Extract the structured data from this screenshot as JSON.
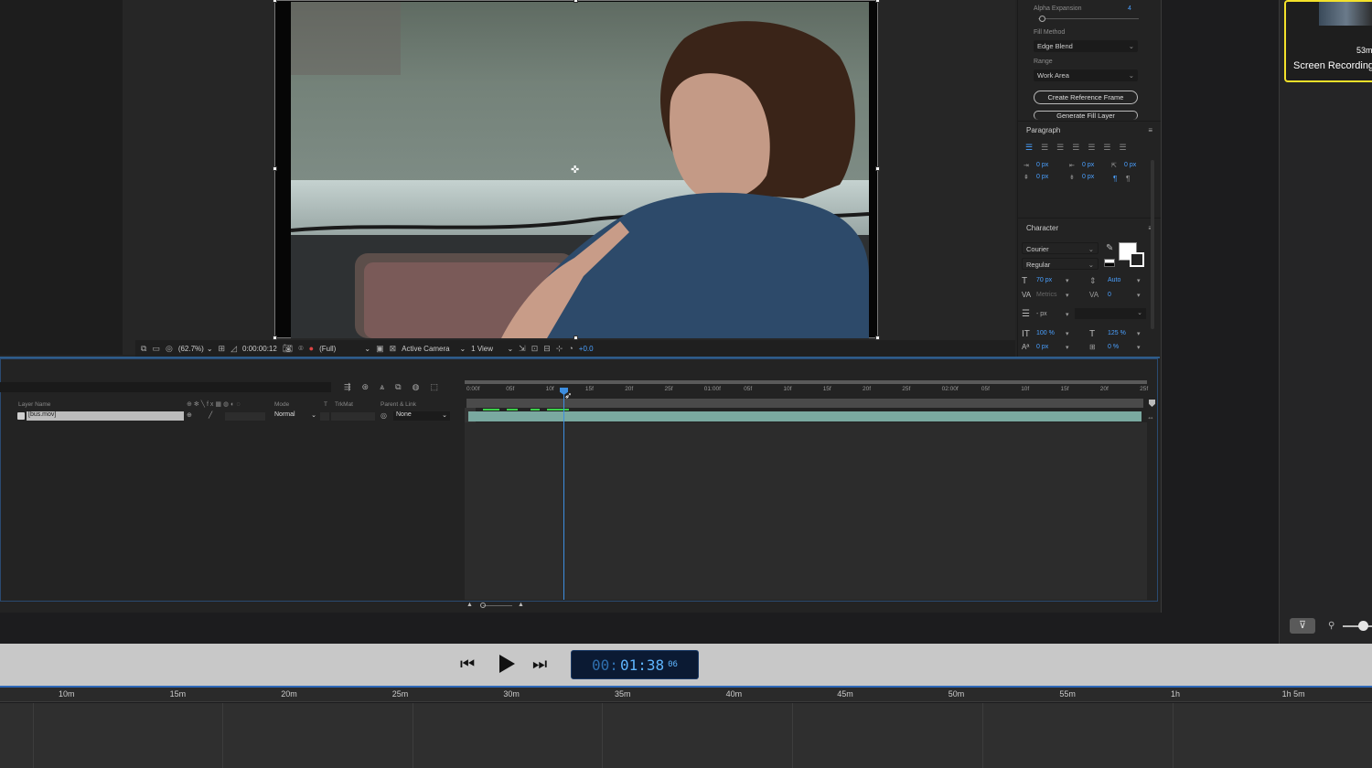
{
  "viewer": {
    "zoom": "(62.7%)",
    "timecode": "0:00:00:12",
    "resolution": "(Full)",
    "camera": "Active Camera",
    "view": "1 View",
    "exposure": "+0.0"
  },
  "fill_panel": {
    "alpha_label": "Alpha Expansion",
    "alpha_value": "4",
    "fill_method_label": "Fill Method",
    "fill_method_value": "Edge Blend",
    "range_label": "Range",
    "range_value": "Work Area",
    "create_ref_btn": "Create Reference Frame",
    "generate_btn": "Generate Fill Layer"
  },
  "paragraph": {
    "title": "Paragraph",
    "indent_left": "0 px",
    "indent_right": "0 px",
    "indent_first": "0 px",
    "space_before": "0 px",
    "space_after": "0 px"
  },
  "character": {
    "title": "Character",
    "font": "Courier",
    "style": "Regular",
    "size": "70 px",
    "leading": "Auto",
    "kerning": "Metrics",
    "tracking": "0",
    "stroke": "- px",
    "vscale": "100 %",
    "hscale": "125 %",
    "baseline": "0 px",
    "tsume": "0 %"
  },
  "timeline": {
    "col_layer_name": "Layer Name",
    "col_mode": "Mode",
    "col_t": "T",
    "col_trkmat": "TrkMat",
    "col_parent": "Parent & Link",
    "layer_name": "[bus.mov]",
    "layer_mode": "Normal",
    "layer_parent": "None",
    "ruler_ticks": [
      "0:00f",
      "05f",
      "10f",
      "15f",
      "20f",
      "25f",
      "01:00f",
      "05f",
      "10f",
      "15f",
      "20f",
      "25f",
      "02:00f",
      "05f",
      "10f",
      "15f",
      "20f",
      "25f"
    ]
  },
  "player": {
    "timecode_dim": "00:",
    "timecode_main": "01:38",
    "timecode_frames": "06"
  },
  "bottom_ruler": [
    "10m",
    "15m",
    "20m",
    "25m",
    "30m",
    "35m",
    "40m",
    "45m",
    "50m",
    "55m",
    "1h",
    "1h 5m"
  ],
  "clip": {
    "label": "Screen Recording",
    "duration": "53m"
  }
}
